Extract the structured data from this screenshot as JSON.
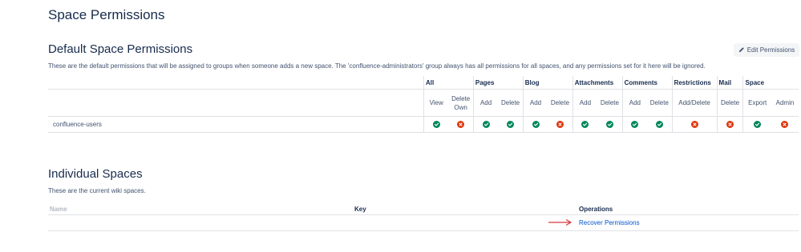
{
  "page": {
    "title": "Space Permissions"
  },
  "default_section": {
    "title": "Default Space Permissions",
    "description": "These are the default permissions that will be assigned to groups when someone adds a new space. The 'confluence-administrators' group always has all permissions for all spaces, and any permissions set for it here will be ignored.",
    "edit_button": "Edit Permissions",
    "groups": [
      {
        "label": "All",
        "perms": [
          "View",
          "Delete Own"
        ]
      },
      {
        "label": "Pages",
        "perms": [
          "Add",
          "Delete"
        ]
      },
      {
        "label": "Blog",
        "perms": [
          "Add",
          "Delete"
        ]
      },
      {
        "label": "Attachments",
        "perms": [
          "Add",
          "Delete"
        ]
      },
      {
        "label": "Comments",
        "perms": [
          "Add",
          "Delete"
        ]
      },
      {
        "label": "Restrictions",
        "perms": [
          "Add/Delete"
        ]
      },
      {
        "label": "Mail",
        "perms": [
          "Delete"
        ]
      },
      {
        "label": "Space",
        "perms": [
          "Export",
          "Admin"
        ]
      }
    ],
    "rows": [
      {
        "group": "confluence-users",
        "granted": [
          true,
          false,
          true,
          true,
          true,
          false,
          true,
          true,
          true,
          true,
          false,
          false,
          true,
          false
        ]
      }
    ]
  },
  "individual_section": {
    "title": "Individual Spaces",
    "description": "These are the current wiki spaces.",
    "columns": {
      "name": "Name",
      "key": "Key",
      "operations": "Operations"
    },
    "rows": [
      {
        "operation_link": "Recover Permissions"
      }
    ]
  },
  "colors": {
    "granted": "#00875a",
    "denied": "#de350b",
    "link": "#0052cc",
    "annotation_arrow": "#d9383a"
  },
  "icons": {
    "granted": "check-circle-icon",
    "denied": "cross-circle-icon",
    "edit": "pencil-icon"
  }
}
